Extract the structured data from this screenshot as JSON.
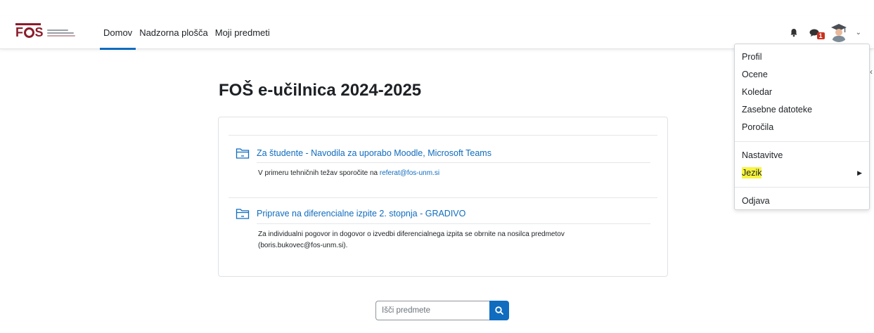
{
  "brand": {
    "logo_text": "FOS",
    "accent_color": "#8b1c2b",
    "link_color": "#0f6cbf"
  },
  "nav": {
    "links": [
      {
        "label": "Domov",
        "active": true
      },
      {
        "label": "Nadzorna plošča",
        "active": false
      },
      {
        "label": "Moji predmeti",
        "active": false
      }
    ],
    "notifications_icon": "bell-icon",
    "messages_icon": "chat-icon",
    "messages_badge": "1"
  },
  "user_menu": {
    "items": [
      {
        "label": "Profil"
      },
      {
        "label": "Ocene"
      },
      {
        "label": "Koledar"
      },
      {
        "label": "Zasebne datoteke"
      },
      {
        "label": "Poročila"
      }
    ],
    "items2": [
      {
        "label": "Nastavitve"
      },
      {
        "label": "Jezik",
        "highlighted": true,
        "has_submenu": true
      }
    ],
    "items3": [
      {
        "label": "Odjava"
      }
    ]
  },
  "main": {
    "title": "FOŠ e-učilnica 2024-2025",
    "activities": [
      {
        "title": "Za študente - Navodila za uporabo Moodle, Microsoft Teams",
        "desc_prefix": "V primeru tehničnih težav sporočite na ",
        "desc_link": "referat@fos-unm.si"
      },
      {
        "title": "Priprave na diferencialne izpite 2. stopnja - GRADIVO",
        "desc_line1": "Za individualni pogovor in dogovor o izvedbi diferencialnega izpita se obrnite na nosilca predmetov",
        "desc_line2": "(boris.bukovec@fos-unm.si)."
      }
    ]
  },
  "search": {
    "placeholder": "Išči predmete"
  }
}
